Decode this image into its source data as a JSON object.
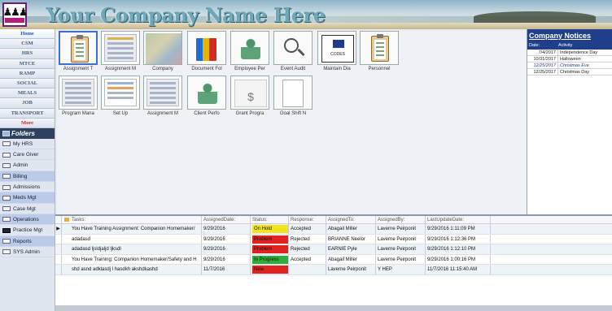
{
  "header": {
    "title": "Your Company Name Here"
  },
  "nav": {
    "buttons": [
      "Home",
      "CSM",
      "HRS",
      "MTCE",
      "RAMP",
      "SOCIAL",
      "MEALS",
      "JOB",
      "TRANSPORT",
      "More"
    ],
    "folders_label": "Folders",
    "folders": [
      "My HRS",
      "Care Giver",
      "Admin",
      "Billing",
      "Admissions",
      "Meds Mgt",
      "Case Mgt",
      "Operations",
      "Practice Mgt",
      "Reports",
      "SYS Admin"
    ]
  },
  "tiles": {
    "row1": [
      "Assignment T",
      "Assignment M",
      "Company",
      "Document Fol",
      "Employee Per",
      "Event Audit",
      "Maintain Dia",
      "Personnel"
    ],
    "row2": [
      "Program Mana",
      "Set Up",
      "Assignment M",
      "Client Perfo",
      "Grant Progra",
      "Goal Shift N"
    ],
    "codes_text": "CODES",
    "dollar": "$"
  },
  "notices": {
    "title": "Company Notices",
    "col_date": "Date:",
    "col_activity": "Activity",
    "rows": [
      {
        "date": "7/4/2017",
        "activity": "Independence Day"
      },
      {
        "date": "10/31/2017",
        "activity": "Halloween"
      },
      {
        "date": "12/25/2017",
        "activity": "Christmas Eve"
      },
      {
        "date": "12/25/2017",
        "activity": "Christmas Day"
      }
    ]
  },
  "tasks": {
    "headers": [
      "Tasks:",
      "AssignedDate:",
      "Status:",
      "Response:",
      "AssignedTo:",
      "AssignedBy:",
      "LastUpdateDate:"
    ],
    "rows": [
      {
        "task": "You Have Training Assignment: Companion Homemaker/",
        "date": "9/29/2016",
        "status": "On Hold",
        "response": "Accepted",
        "to": "Abagail Miller",
        "by": "Laverne Peirponit",
        "updated": "9/29/2016 1:11:09 PM"
      },
      {
        "task": "adadasd",
        "date": "9/29/2016",
        "status": "Problem",
        "response": "Rejected",
        "to": "BRIANNE Neelor",
        "by": "Laverne Peirponit",
        "updated": "9/29/2016 1:12:36 PM"
      },
      {
        "task": "adadasd ljsldjaljd ljksdl",
        "date": "9/29/2016",
        "status": "Problem",
        "response": "Rejected",
        "to": "EARNIE Pyle",
        "by": "Laverne Peirponit",
        "updated": "9/29/2016 1:12:10 PM"
      },
      {
        "task": "You Have Training: Companion Homemaker/Safety and H",
        "date": "9/29/2016",
        "status": "In Progress",
        "response": "Accepted",
        "to": "Abagail Miller",
        "by": "Laverne Peirponit",
        "updated": "9/29/2016 1:00:16 PM"
      },
      {
        "task": "shd  asnd adklasdj l   hasdkh akshdkashd",
        "date": "11/7/2016",
        "status": "New",
        "response": "",
        "to": "Laverne Peirponit",
        "by": "Y HEP",
        "updated": "11/7/2016 11:15:40 AM"
      }
    ]
  },
  "status_colors": {
    "On Hold": "#f2e51d",
    "Problem": "#e0231f",
    "In Progress": "#2fae3a",
    "New": "#e0231f"
  }
}
